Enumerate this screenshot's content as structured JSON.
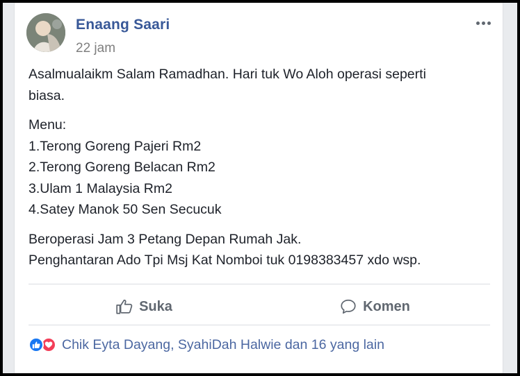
{
  "post": {
    "author": "Enaang Saari",
    "time": "22 jam",
    "paragraphs": {
      "intro": [
        "Asalmualaikm Salam Ramadhan. Hari tuk Wo Aloh operasi seperti",
        "biasa."
      ],
      "menu": [
        "Menu:",
        "1.Terong Goreng Pajeri Rm2",
        "2.Terong Goreng Belacan Rm2",
        "3.Ulam 1 Malaysia Rm2",
        "4.Satey Manok 50 Sen Secucuk"
      ],
      "info": [
        "Beroperasi Jam 3 Petang Depan Rumah Jak.",
        "Penghantaran Ado Tpi Msj Kat Nomboi tuk 0198383457 xdo wsp."
      ]
    }
  },
  "actions": {
    "like_label": "Suka",
    "comment_label": "Komen"
  },
  "reactions": {
    "summary": "Chik Eyta Dayang, SyahiDah Halwie dan 16 yang lain",
    "icons": [
      "like-icon",
      "love-icon"
    ]
  },
  "colors": {
    "author": "#385898",
    "like": "#1877f2",
    "love": "#f33e58"
  }
}
